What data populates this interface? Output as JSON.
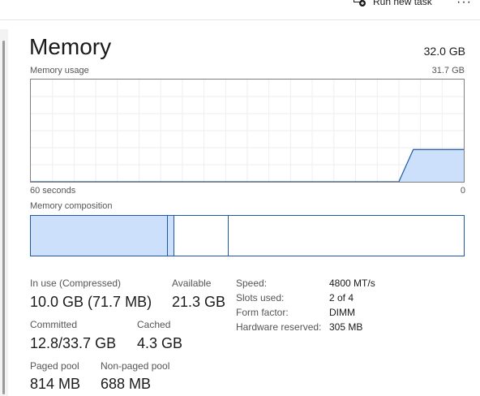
{
  "toolbar": {
    "run_new_task": "Run new task",
    "more": "···"
  },
  "header": {
    "title": "Memory",
    "total": "32.0 GB"
  },
  "usage_chart": {
    "label": "Memory usage",
    "max_label": "31.7 GB",
    "x_left": "60 seconds",
    "x_right": "0",
    "chart_data": {
      "type": "area",
      "x": [
        0,
        51,
        53,
        60
      ],
      "y": [
        0,
        0,
        10.0,
        10.0
      ],
      "ylim": [
        0,
        31.7
      ],
      "xlabel": "",
      "ylabel": "",
      "grid": true
    }
  },
  "composition": {
    "label": "Memory composition",
    "in_use_fraction": 0.317,
    "modified_fraction": 0.015,
    "standby_fraction": 0.125
  },
  "stats": {
    "in_use_label": "In use (Compressed)",
    "in_use_value": "10.0 GB (71.7 MB)",
    "available_label": "Available",
    "available_value": "21.3 GB",
    "committed_label": "Committed",
    "committed_value": "12.8/33.7 GB",
    "cached_label": "Cached",
    "cached_value": "4.3 GB",
    "paged_label": "Paged pool",
    "paged_value": "814 MB",
    "nonpaged_label": "Non-paged pool",
    "nonpaged_value": "688 MB"
  },
  "specs": [
    {
      "key": "Speed:",
      "value": "4800 MT/s"
    },
    {
      "key": "Slots used:",
      "value": "2 of 4"
    },
    {
      "key": "Form factor:",
      "value": "DIMM"
    },
    {
      "key": "Hardware reserved:",
      "value": "305 MB"
    }
  ],
  "colors": {
    "accent": "#1d57a6",
    "fill": "#cce0fb",
    "grid": "#eeeeee"
  }
}
